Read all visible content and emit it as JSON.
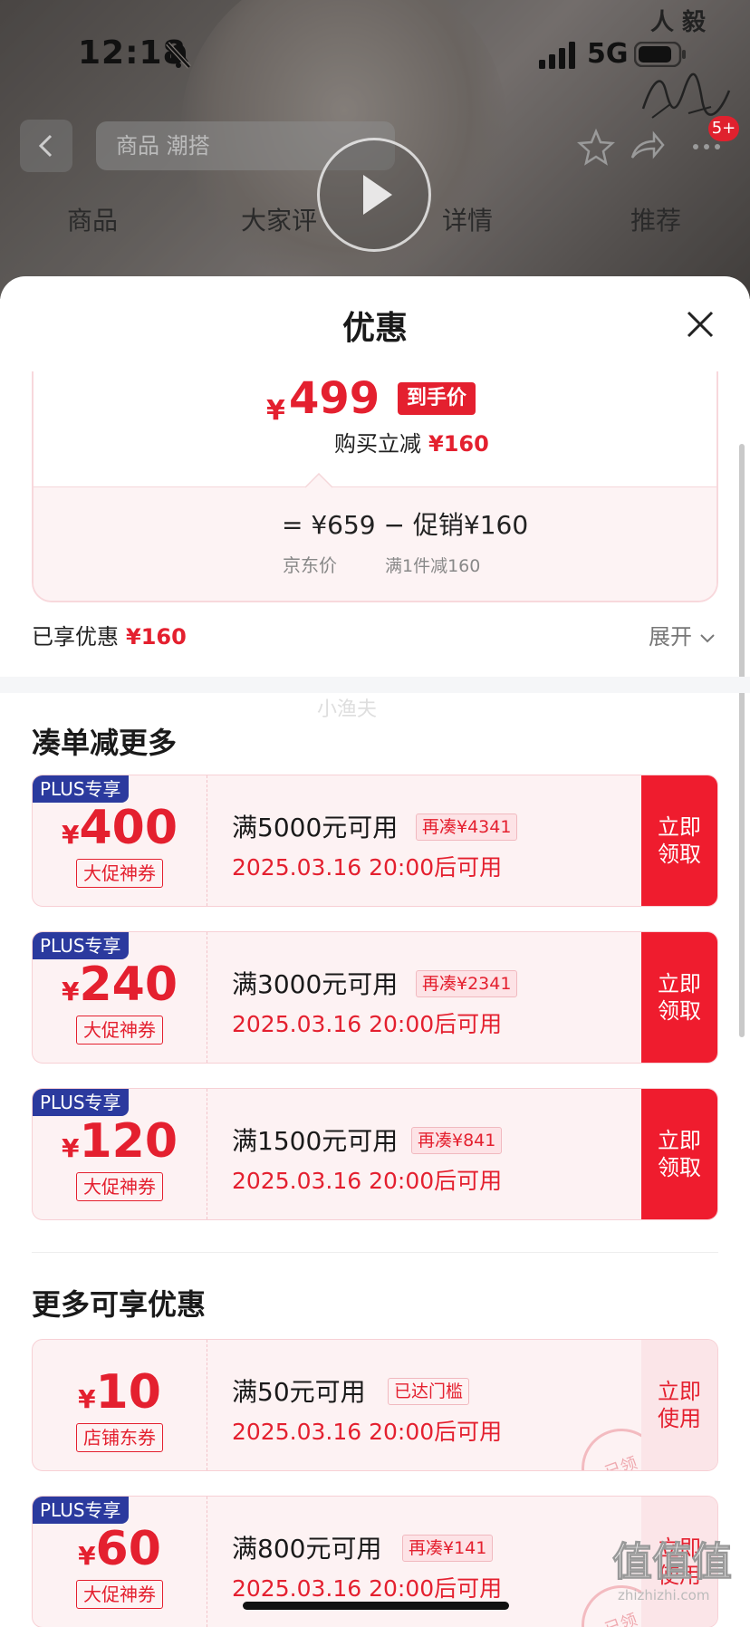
{
  "status": {
    "time": "12:18",
    "network": "5G"
  },
  "brand": "人 毅",
  "nav": {
    "search_placeholder": "商品  潮搭",
    "cart_badge": "5+"
  },
  "tabs": [
    "商品",
    "大家评",
    "详情",
    "推荐"
  ],
  "sheet": {
    "title": "优惠",
    "price": {
      "currency": "¥",
      "final": "499",
      "tag": "到手价",
      "cut_label": "购买立减",
      "cut_value": "¥160",
      "formula": "=  ¥659  −  促销¥160",
      "label_jd": "京东价",
      "label_promo": "满1件减160"
    },
    "enjoyed_label": "已享优惠",
    "enjoyed_value": "¥160",
    "expand_label": "展开",
    "section1_title": "凑单减更多",
    "section2_title": "更多可享优惠",
    "watermark": "小渔夫",
    "coupons": [
      {
        "plus": "PLUS专享",
        "currency": "¥",
        "amount": "400",
        "kind": "大促神券",
        "cond": "满5000元可用",
        "hint": "再凑¥4341",
        "date": "2025.03.16 20:00后可用",
        "btn1": "立即",
        "btn2": "领取"
      },
      {
        "plus": "PLUS专享",
        "currency": "¥",
        "amount": "240",
        "kind": "大促神券",
        "cond": "满3000元可用",
        "hint": "再凑¥2341",
        "date": "2025.03.16 20:00后可用",
        "btn1": "立即",
        "btn2": "领取"
      },
      {
        "plus": "PLUS专享",
        "currency": "¥",
        "amount": "120",
        "kind": "大促神券",
        "cond": "满1500元可用",
        "hint": "再凑¥841",
        "date": "2025.03.16 20:00后可用",
        "btn1": "立即",
        "btn2": "领取"
      }
    ],
    "more_coupons": [
      {
        "plus": "",
        "currency": "¥",
        "amount": "10",
        "kind": "店铺东券",
        "cond": "满50元可用",
        "hint": "已达门槛",
        "date": "2025.03.16 20:00后可用",
        "btn1": "立即",
        "btn2": "使用",
        "stamp": "已领"
      },
      {
        "plus": "PLUS专享",
        "currency": "¥",
        "amount": "60",
        "kind": "大促神券",
        "cond": "满800元可用",
        "hint": "再凑¥141",
        "date": "2025.03.16 20:00后可用",
        "btn1": "立即",
        "btn2": "使用",
        "stamp": "已领"
      }
    ]
  },
  "corner_watermark": {
    "big": "值值值",
    "small": "zhizhizhi.com"
  },
  "colors": {
    "accent": "#e4202f",
    "plus": "#2b3a9e",
    "coupon_bg": "#fdf2f3"
  }
}
